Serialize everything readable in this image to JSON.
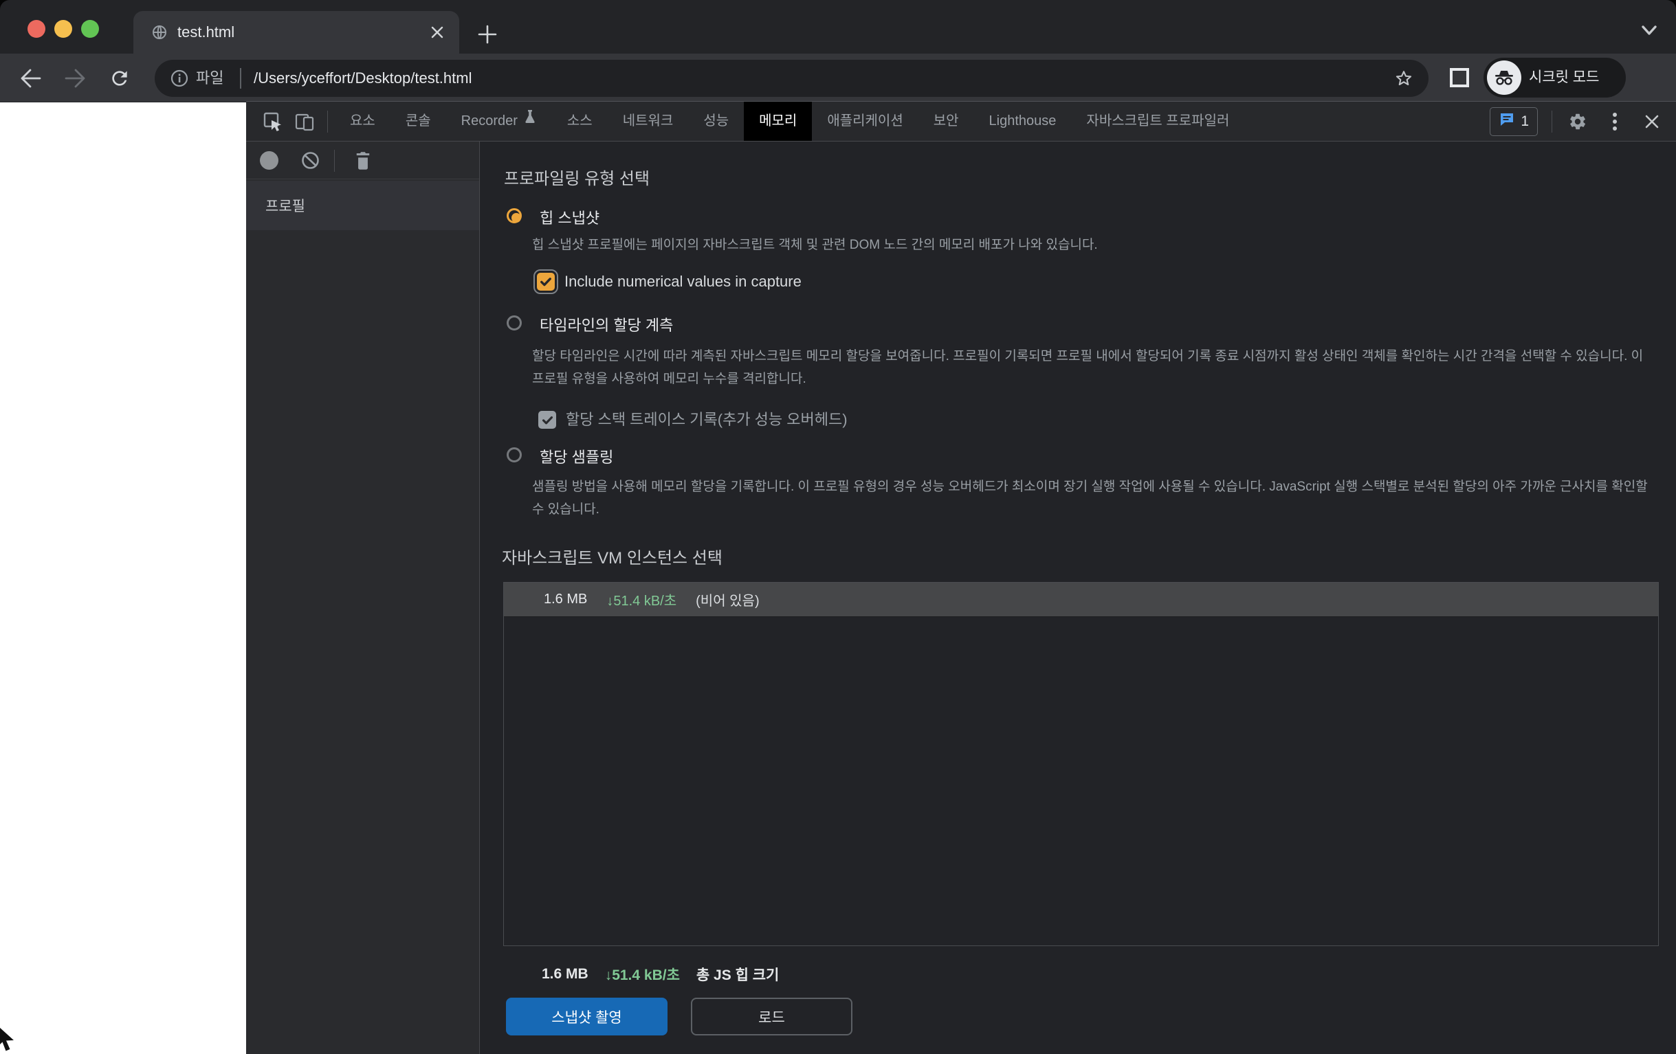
{
  "colors": {
    "accent_orange": "#eda63c",
    "rate_green": "#81c995",
    "primary_button_blue": "#1769b5",
    "issues_icon_blue": "#4f9df0"
  },
  "browser": {
    "tab_title": "test.html",
    "url_prefix": "파일",
    "url": "/Users/yceffort/Desktop/test.html",
    "incognito_label": "시크릿 모드"
  },
  "devtools": {
    "tabs": [
      "요소",
      "콘솔",
      "Recorder",
      "소스",
      "네트워크",
      "성능",
      "메모리",
      "애플리케이션",
      "보안",
      "Lighthouse",
      "자바스크립트 프로파일러"
    ],
    "active_tab": "메모리",
    "issues_count": "1",
    "sidebar": {
      "profiles_header": "프로필"
    }
  },
  "profiling": {
    "heading": "프로파일링 유형 선택",
    "options": [
      {
        "label": "힙 스냅샷",
        "description": "힙 스냅샷 프로필에는 페이지의 자바스크립트 객체 및 관련 DOM 노드 간의 메모리 배포가 나와 있습니다.",
        "selected": true
      },
      {
        "label": "타임라인의 할당 계측",
        "description": "할당 타임라인은 시간에 따라 계측된 자바스크립트 메모리 할당을 보여줍니다. 프로필이 기록되면 프로필 내에서 할당되어 기록 종료 시점까지 활성 상태인 객체를 확인하는 시간 간격을 선택할 수 있습니다. 이 프로필 유형을 사용하여 메모리 누수를 격리합니다.",
        "selected": false
      },
      {
        "label": "할당 샘플링",
        "description": "샘플링 방법을 사용해 메모리 할당을 기록합니다. 이 프로필 유형의 경우 성능 오버헤드가 최소이며 장기 실행 작업에 사용될 수 있습니다. JavaScript 실행 스택별로 분석된 할당의 아주 가까운 근사치를 확인할 수 있습니다.",
        "selected": false
      }
    ],
    "heap_snapshot_checkbox": "Include numerical values in capture",
    "timeline_checkbox": "할당 스택 트레이스 기록(추가 성능 오버헤드)"
  },
  "vm_instances": {
    "heading": "자바스크립트 VM 인스턴스 선택",
    "arrow_glyph": "↓",
    "row": {
      "heap_size": "1.6 MB",
      "change_rate": "51.4 kB/초",
      "state": "(비어 있음)"
    },
    "total": {
      "heap_size": "1.6 MB",
      "change_rate": "51.4 kB/초",
      "label": "총 JS 힙 크기"
    }
  },
  "actions": {
    "take_snapshot": "스냅샷 촬영",
    "load": "로드"
  }
}
